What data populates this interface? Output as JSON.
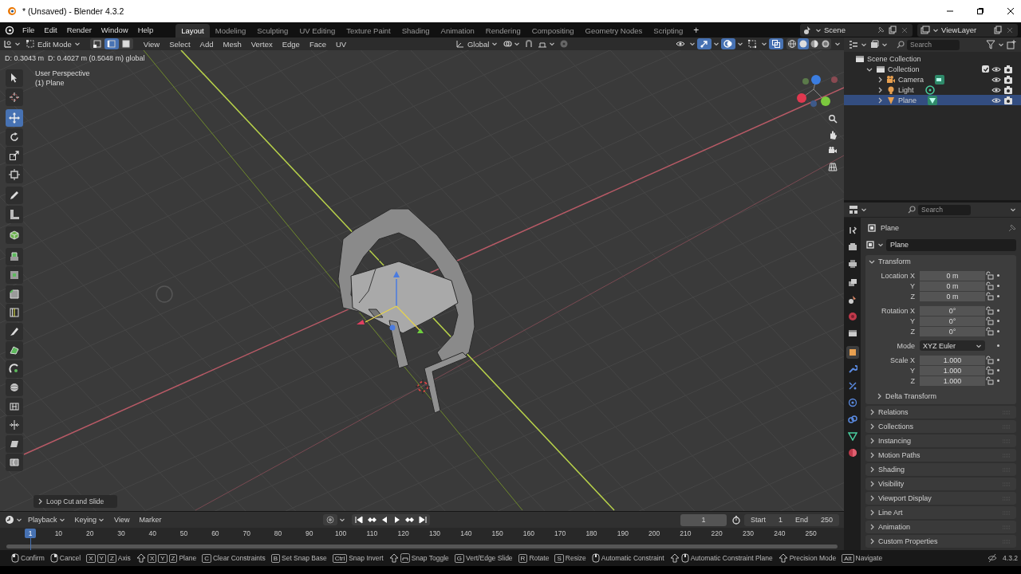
{
  "window": {
    "title": "* (Unsaved) - Blender 4.3.2"
  },
  "menu": [
    "File",
    "Edit",
    "Render",
    "Window",
    "Help"
  ],
  "workspaces": [
    {
      "label": "Layout",
      "selected": true
    },
    {
      "label": "Modeling",
      "selected": false
    },
    {
      "label": "Sculpting",
      "selected": false
    },
    {
      "label": "UV Editing",
      "selected": false
    },
    {
      "label": "Texture Paint",
      "selected": false
    },
    {
      "label": "Shading",
      "selected": false
    },
    {
      "label": "Animation",
      "selected": false
    },
    {
      "label": "Rendering",
      "selected": false
    },
    {
      "label": "Compositing",
      "selected": false
    },
    {
      "label": "Geometry Nodes",
      "selected": false
    },
    {
      "label": "Scripting",
      "selected": false
    }
  ],
  "add_workspace": "+",
  "scene": "Scene",
  "view_layer": "ViewLayer",
  "viewport": {
    "mode": "Edit Mode",
    "select_modes": [
      {
        "kind": "vertex",
        "selected": false
      },
      {
        "kind": "edge",
        "selected": true
      },
      {
        "kind": "face",
        "selected": false
      }
    ],
    "menus": [
      "View",
      "Select",
      "Add",
      "Mesh",
      "Vertex",
      "Edge",
      "Face",
      "UV"
    ],
    "orientation": "Global",
    "snap": {
      "on": false
    },
    "proportional": {
      "on": false
    },
    "toggles": [
      {
        "kind": "visibility",
        "on": false
      },
      {
        "kind": "gizmos",
        "on": true
      },
      {
        "kind": "overlays",
        "on": true
      },
      {
        "kind": "mesh-overlays",
        "on": false
      },
      {
        "kind": "xray",
        "on": true
      }
    ],
    "shading": [
      {
        "kind": "wireframe",
        "selected": false
      },
      {
        "kind": "solid",
        "selected": true
      },
      {
        "kind": "material",
        "selected": false
      },
      {
        "kind": "rendered",
        "selected": false
      }
    ],
    "readout": "D: 0.3043 m  D: 0.4027 m (0.5048 m) global",
    "view_name": "User Perspective",
    "object_label": "(1) Plane",
    "tools": [
      {
        "kind": "select",
        "selected": false
      },
      {
        "kind": "cursor",
        "selected": false
      },
      {
        "kind": "move",
        "selected": true
      },
      {
        "kind": "rotate",
        "selected": false
      },
      {
        "kind": "scale",
        "selected": false
      },
      {
        "kind": "transform",
        "selected": false
      },
      {
        "kind": "annotate",
        "selected": false
      },
      {
        "kind": "measure",
        "selected": false
      },
      {
        "kind": "add-cube",
        "selected": false
      },
      {
        "kind": "extrude",
        "selected": false
      },
      {
        "kind": "inset",
        "selected": false
      },
      {
        "kind": "bevel",
        "selected": false
      },
      {
        "kind": "loop-cut",
        "selected": false
      },
      {
        "kind": "knife",
        "selected": false
      },
      {
        "kind": "poly-build",
        "selected": false
      },
      {
        "kind": "spin",
        "selected": false
      },
      {
        "kind": "smooth",
        "selected": false
      },
      {
        "kind": "edge-slide",
        "selected": false
      },
      {
        "kind": "shrink",
        "selected": false
      },
      {
        "kind": "shear",
        "selected": false
      },
      {
        "kind": "rip",
        "selected": false
      }
    ],
    "last_operator": {
      "label": "Loop Cut and Slide",
      "expanded": false
    }
  },
  "outliner": {
    "search_placeholder": "Search",
    "tree": [
      {
        "label": "Scene Collection",
        "kind": "scene-collection",
        "selected": false,
        "children": [
          {
            "label": "Collection",
            "kind": "collection",
            "selected": false,
            "expanded": true,
            "checked": true,
            "children": [
              {
                "label": "Camera",
                "kind": "camera",
                "selected": false,
                "expanded": false
              },
              {
                "label": "Light",
                "kind": "light",
                "selected": false,
                "expanded": false
              },
              {
                "label": "Plane",
                "kind": "mesh",
                "selected": true,
                "expanded": false
              }
            ]
          }
        ]
      }
    ]
  },
  "properties": {
    "search_placeholder": "Search",
    "tabs": [
      {
        "kind": "tool",
        "selected": false
      },
      {
        "kind": "render",
        "selected": false
      },
      {
        "kind": "output",
        "selected": false
      },
      {
        "kind": "view-layer",
        "selected": false
      },
      {
        "kind": "scene",
        "selected": false
      },
      {
        "kind": "world",
        "selected": false
      },
      {
        "kind": "collection",
        "selected": false
      },
      {
        "kind": "object",
        "selected": true
      },
      {
        "kind": "modifiers",
        "selected": false
      },
      {
        "kind": "particles",
        "selected": false
      },
      {
        "kind": "physics",
        "selected": false
      },
      {
        "kind": "constraints",
        "selected": false
      },
      {
        "kind": "data",
        "selected": false
      },
      {
        "kind": "material",
        "selected": false
      }
    ],
    "context": "Plane",
    "object_name": "Plane",
    "transform": {
      "label": "Transform",
      "expanded": true,
      "groups": [
        {
          "kind": "fields",
          "rows": [
            {
              "label": "Location X",
              "value": "0 m"
            },
            {
              "label": "Y",
              "value": "0 m"
            },
            {
              "label": "Z",
              "value": "0 m"
            }
          ]
        },
        {
          "kind": "fields",
          "rows": [
            {
              "label": "Rotation X",
              "value": "0°"
            },
            {
              "label": "Y",
              "value": "0°"
            },
            {
              "label": "Z",
              "value": "0°"
            }
          ]
        },
        {
          "kind": "dropdown",
          "label": "Mode",
          "value": "XYZ Euler"
        },
        {
          "kind": "fields",
          "rows": [
            {
              "label": "Scale X",
              "value": "1.000"
            },
            {
              "label": "Y",
              "value": "1.000"
            },
            {
              "label": "Z",
              "value": "1.000"
            }
          ]
        }
      ],
      "subpanel": {
        "label": "Delta Transform",
        "expanded": false
      }
    },
    "panels": [
      {
        "label": "Relations",
        "expanded": false
      },
      {
        "label": "Collections",
        "expanded": false
      },
      {
        "label": "Instancing",
        "expanded": false
      },
      {
        "label": "Motion Paths",
        "expanded": false
      },
      {
        "label": "Shading",
        "expanded": false
      },
      {
        "label": "Visibility",
        "expanded": false
      },
      {
        "label": "Viewport Display",
        "expanded": false
      },
      {
        "label": "Line Art",
        "expanded": false
      },
      {
        "label": "Animation",
        "expanded": false
      },
      {
        "label": "Custom Properties",
        "expanded": false
      }
    ]
  },
  "timeline": {
    "menus": [
      {
        "label": "Playback",
        "dropdown": true
      },
      {
        "label": "Keying",
        "dropdown": true
      },
      {
        "label": "View",
        "dropdown": false
      },
      {
        "label": "Marker",
        "dropdown": false
      }
    ],
    "current_frame": "1",
    "start_label": "Start",
    "start": "1",
    "end_label": "End",
    "end": "250",
    "playhead": "1",
    "ticks": [
      "10",
      "20",
      "30",
      "40",
      "50",
      "60",
      "70",
      "80",
      "90",
      "100",
      "110",
      "120",
      "130",
      "140",
      "150",
      "160",
      "170",
      "180",
      "190",
      "200",
      "210",
      "220",
      "230",
      "240",
      "250"
    ]
  },
  "status_bar": {
    "hints": [
      {
        "keys": [
          {
            "kind": "mouse-left"
          }
        ],
        "label": "Confirm"
      },
      {
        "keys": [
          {
            "kind": "mouse-right"
          }
        ],
        "label": "Cancel"
      },
      {
        "keys": [
          {
            "kind": "key",
            "text": "X"
          },
          {
            "kind": "key",
            "text": "Y"
          },
          {
            "kind": "key",
            "text": "Z"
          }
        ],
        "label": "Axis"
      },
      {
        "keys": [
          {
            "kind": "shift"
          },
          {
            "kind": "key",
            "text": "X"
          },
          {
            "kind": "key",
            "text": "Y"
          },
          {
            "kind": "key",
            "text": "Z"
          }
        ],
        "label": "Plane"
      },
      {
        "keys": [
          {
            "kind": "key",
            "text": "C"
          }
        ],
        "label": "Clear Constraints"
      },
      {
        "keys": [
          {
            "kind": "key",
            "text": "B"
          }
        ],
        "label": "Set Snap Base"
      },
      {
        "keys": [
          {
            "kind": "key",
            "text": "Ctrl"
          }
        ],
        "label": "Snap Invert"
      },
      {
        "keys": [
          {
            "kind": "shift"
          },
          {
            "kind": "snap"
          }
        ],
        "label": "Snap Toggle"
      },
      {
        "keys": [
          {
            "kind": "key",
            "text": "G"
          }
        ],
        "label": "Vert/Edge Slide"
      },
      {
        "keys": [
          {
            "kind": "key",
            "text": "R"
          }
        ],
        "label": "Rotate"
      },
      {
        "keys": [
          {
            "kind": "key",
            "text": "S"
          }
        ],
        "label": "Resize"
      },
      {
        "keys": [
          {
            "kind": "mouse-middle"
          }
        ],
        "label": "Automatic Constraint"
      },
      {
        "keys": [
          {
            "kind": "shift"
          },
          {
            "kind": "mouse-middle"
          }
        ],
        "label": "Automatic Constraint Plane"
      },
      {
        "keys": [
          {
            "kind": "shift"
          }
        ],
        "label": "Precision Mode"
      },
      {
        "keys": [
          {
            "kind": "key",
            "text": "Alt"
          }
        ],
        "label": "Navigate"
      }
    ],
    "version": "4.3.2"
  }
}
